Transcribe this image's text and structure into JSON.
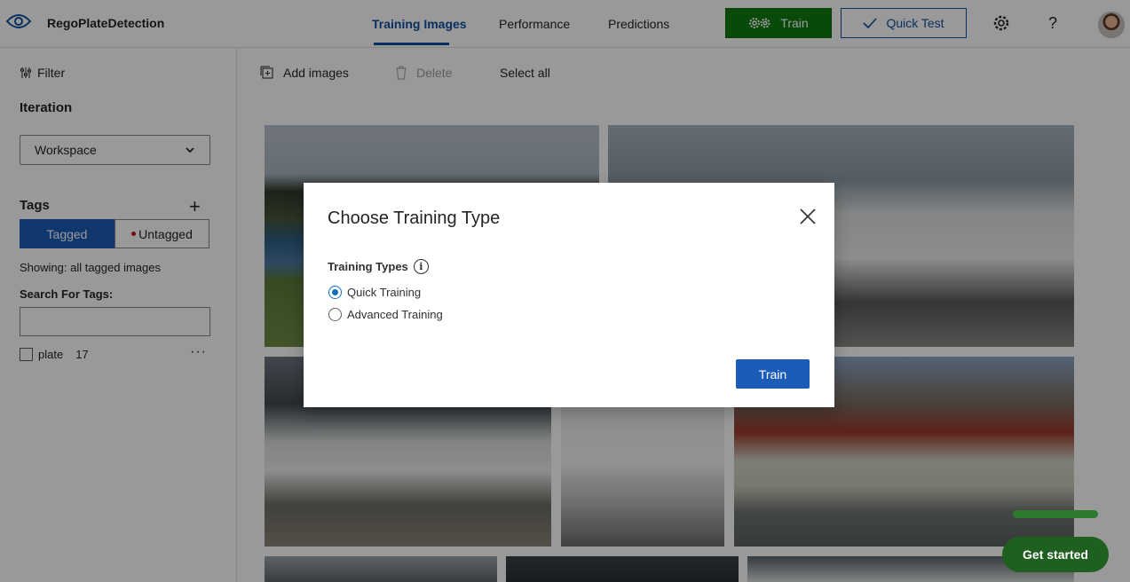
{
  "app": {
    "title": "RegoPlateDetection"
  },
  "nav": {
    "tabs": [
      {
        "label": "Training Images",
        "active": true
      },
      {
        "label": "Performance",
        "active": false
      },
      {
        "label": "Predictions",
        "active": false
      }
    ],
    "train_label": "Train",
    "quick_test_label": "Quick Test",
    "help_label": "?"
  },
  "sidebar": {
    "filter_label": "Filter",
    "iteration_heading": "Iteration",
    "iteration_selected": "Workspace",
    "tags_heading": "Tags",
    "tagged_label": "Tagged",
    "untagged_label": "Untagged",
    "showing_text": "Showing: all tagged images",
    "search_label": "Search For Tags:",
    "search_value": "",
    "tags": [
      {
        "name": "plate",
        "count": "17"
      }
    ]
  },
  "toolbar": {
    "add_images_label": "Add images",
    "delete_label": "Delete",
    "select_all_label": "Select all"
  },
  "dialog": {
    "title": "Choose Training Type",
    "training_types_label": "Training Types",
    "options": [
      {
        "label": "Quick Training",
        "selected": true
      },
      {
        "label": "Advanced Training",
        "selected": false
      }
    ],
    "train_button_label": "Train"
  },
  "get_started_label": "Get started",
  "colors": {
    "accent": "#1b5cb8",
    "train_green": "#0f7b0f",
    "nav_active": "#0f4f9e"
  }
}
